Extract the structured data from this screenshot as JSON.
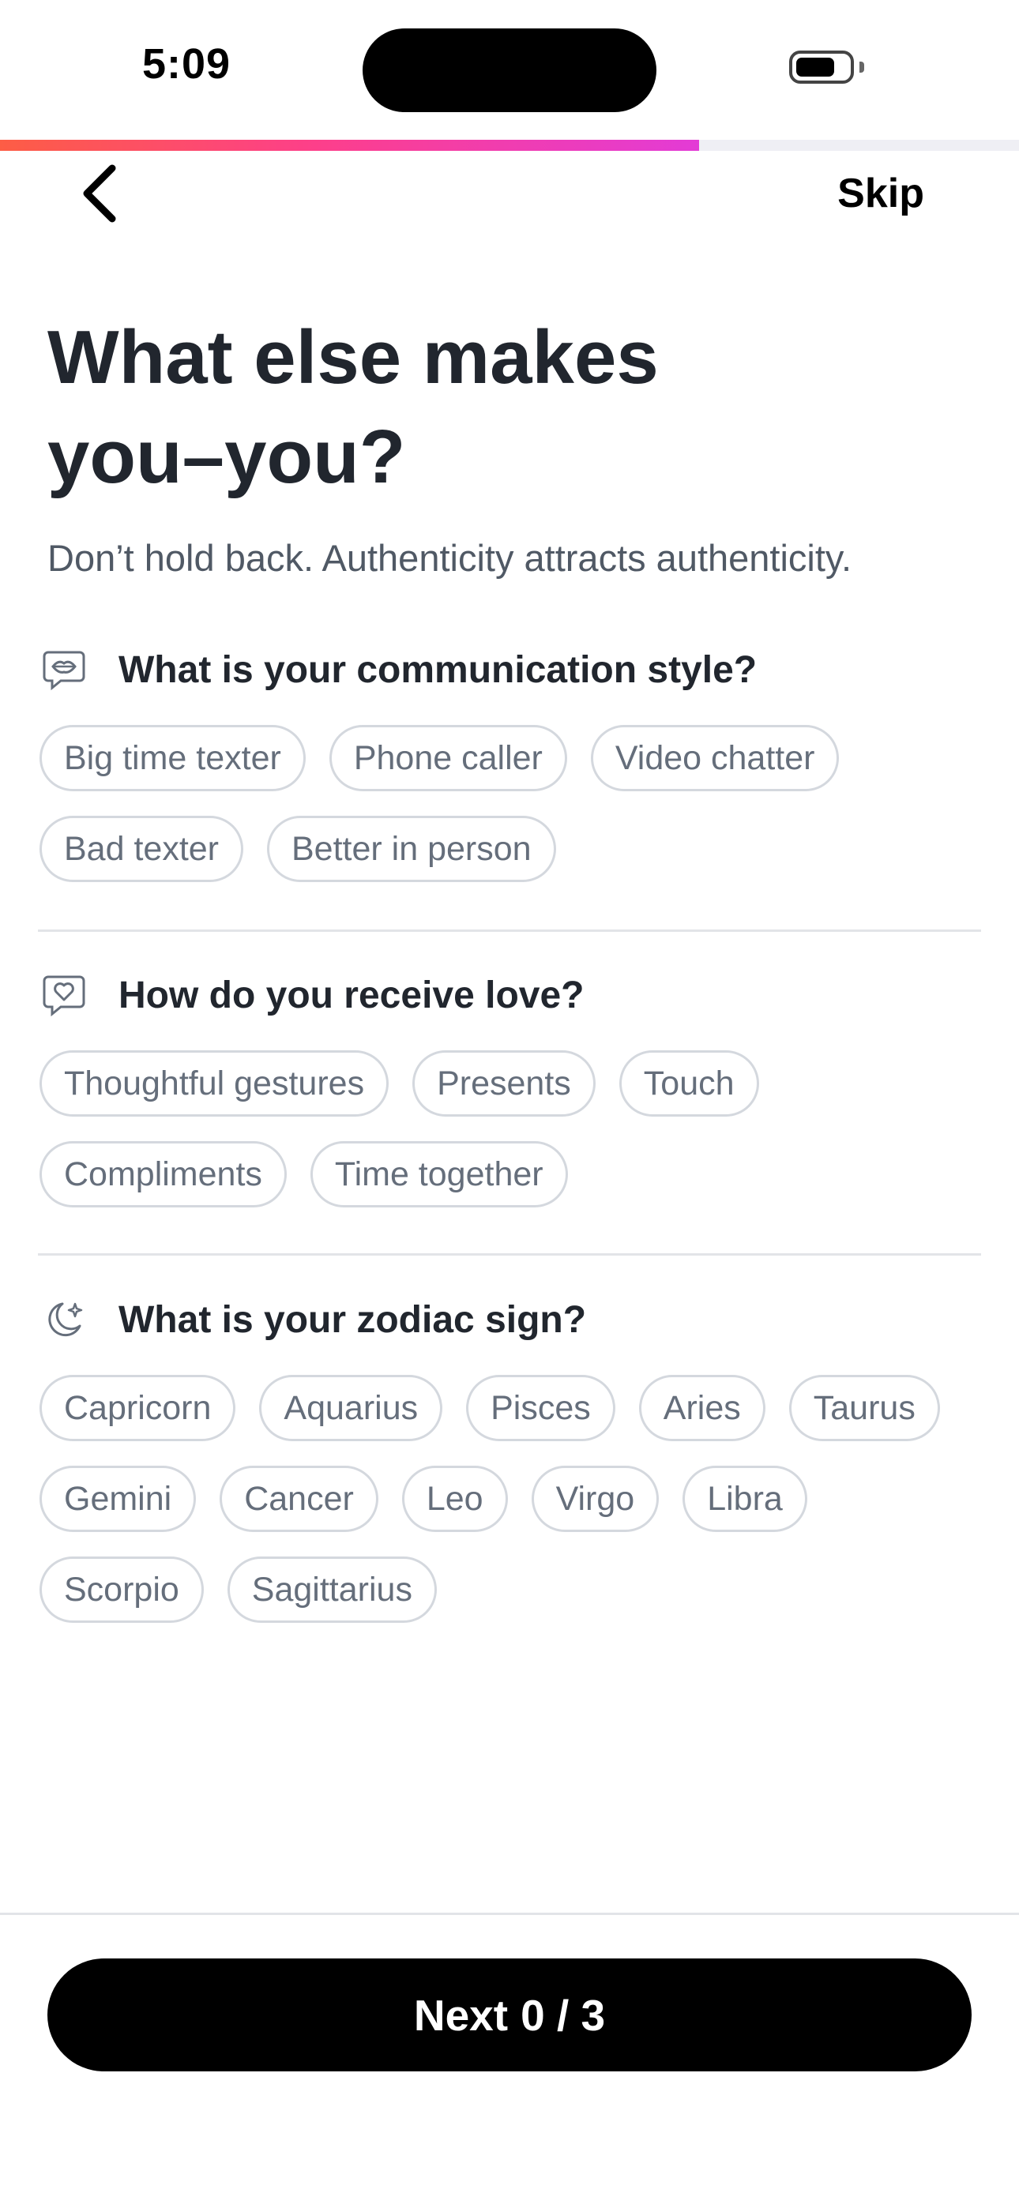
{
  "status_bar": {
    "time": "5:09",
    "battery_level": 0.75
  },
  "progress": {
    "fraction": 0.686,
    "colors": [
      "#fd5d45",
      "#fd3f8a",
      "#e33bd6"
    ]
  },
  "nav": {
    "back_icon": "chevron-left-icon",
    "skip_label": "Skip"
  },
  "header": {
    "title_line1": "What else makes",
    "title_line2": "you–you?",
    "subtitle": "Don’t hold back. Authenticity attracts authenticity."
  },
  "sections": [
    {
      "icon": "lips-chat-icon",
      "title": "What is your communication style?",
      "options": [
        "Big time texter",
        "Phone caller",
        "Video chatter",
        "Bad texter",
        "Better in person"
      ]
    },
    {
      "icon": "heart-chat-icon",
      "title": "How do you receive love?",
      "options": [
        "Thoughtful gestures",
        "Presents",
        "Touch",
        "Compliments",
        "Time together"
      ]
    },
    {
      "icon": "moon-stars-icon",
      "title": "What is your zodiac sign?",
      "options": [
        "Capricorn",
        "Aquarius",
        "Pisces",
        "Aries",
        "Taurus",
        "Gemini",
        "Cancer",
        "Leo",
        "Virgo",
        "Libra",
        "Scorpio",
        "Sagittarius"
      ]
    }
  ],
  "footer": {
    "next_label": "Next",
    "selected_count": "0 / 3"
  },
  "colors": {
    "button_bg": "#000000",
    "chip_border": "#d4d8de",
    "chip_text": "#656e7b",
    "title_text": "#21262e"
  }
}
